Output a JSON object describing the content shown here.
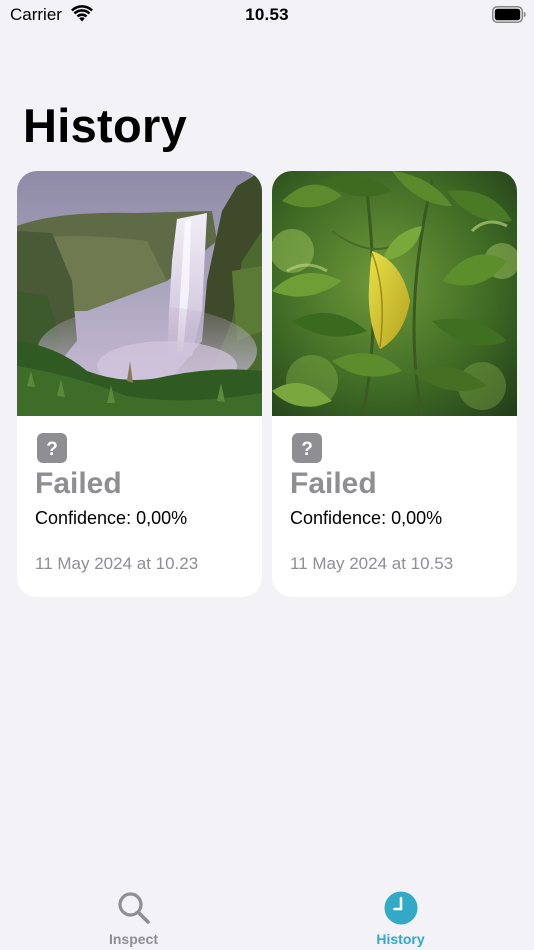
{
  "status_bar": {
    "carrier": "Carrier",
    "time": "10.53"
  },
  "page": {
    "title": "History"
  },
  "history": [
    {
      "image": "waterfall-photo",
      "status_icon": "question-mark-icon",
      "status": "Failed",
      "confidence": "Confidence: 0,00%",
      "timestamp": "11 May 2024 at 10.23"
    },
    {
      "image": "green-leaves-photo",
      "status_icon": "question-mark-icon",
      "status": "Failed",
      "confidence": "Confidence: 0,00%",
      "timestamp": "11 May 2024 at 10.53"
    }
  ],
  "tab_bar": {
    "tabs": [
      {
        "label": "Inspect",
        "icon": "magnifying-glass-icon",
        "selected": false
      },
      {
        "label": "History",
        "icon": "clock-icon",
        "selected": true
      }
    ]
  },
  "colors": {
    "background": "#f2f2f7",
    "accent": "#31a9c7",
    "secondary_text": "#8e8e93",
    "status_icon": "#8e8e93"
  }
}
